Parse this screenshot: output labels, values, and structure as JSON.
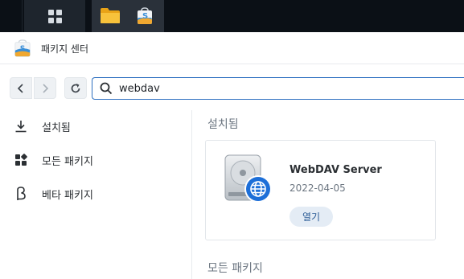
{
  "window": {
    "title": "패키지 센터"
  },
  "search": {
    "value": "webdav"
  },
  "sidebar": {
    "items": [
      {
        "label": "설치됨",
        "icon": "download-icon"
      },
      {
        "label": "모든 패키지",
        "icon": "grid-icon"
      },
      {
        "label": "베타 패키지",
        "icon": "beta-icon"
      }
    ]
  },
  "main": {
    "installed_title": "설치됨",
    "all_title": "모든 패키지",
    "package": {
      "name": "WebDAV Server",
      "date": "2022-04-05",
      "open_label": "열기"
    }
  },
  "colors": {
    "accent": "#2d6fc0",
    "taskbar": "#0b1016",
    "open_button_bg": "#e4ecf5"
  }
}
